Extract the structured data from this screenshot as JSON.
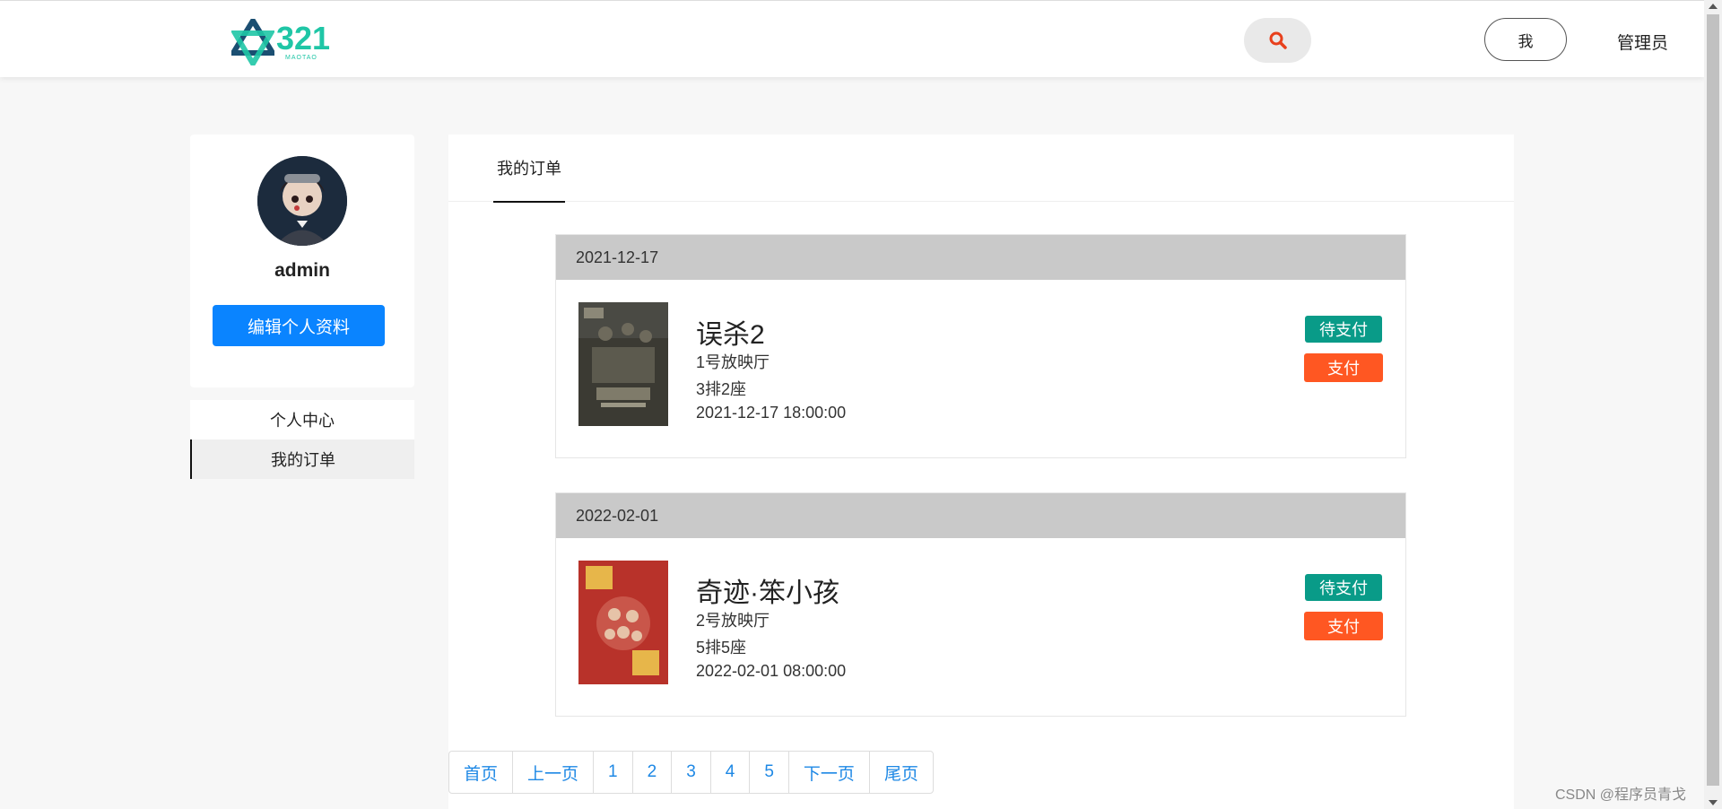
{
  "header": {
    "logo_text": "321",
    "logo_sub": "MAOTAO",
    "me_label": "我",
    "admin_label": "管理员"
  },
  "profile": {
    "username": "admin",
    "edit_label": "编辑个人资料"
  },
  "sidebar": {
    "items": [
      {
        "label": "个人中心",
        "active": false
      },
      {
        "label": "我的订单",
        "active": true
      }
    ]
  },
  "main": {
    "tab_label": "我的订单",
    "orders": [
      {
        "date": "2021-12-17",
        "title": "误杀2",
        "hall": "1号放映厅",
        "seat": "3排2座",
        "showtime": "2021-12-17 18:00:00",
        "status": "待支付",
        "pay_label": "支付"
      },
      {
        "date": "2022-02-01",
        "title": "奇迹·笨小孩",
        "hall": "2号放映厅",
        "seat": "5排5座",
        "showtime": "2022-02-01 08:00:00",
        "status": "待支付",
        "pay_label": "支付"
      }
    ]
  },
  "pagination": {
    "first": "首页",
    "prev": "上一页",
    "pages": [
      "1",
      "2",
      "3",
      "4",
      "5"
    ],
    "next": "下一页",
    "last": "尾页"
  },
  "watermark": "CSDN @程序员青戈",
  "colors": {
    "primary": "#0a84ff",
    "status": "#099b88",
    "pay": "#ff5722",
    "link": "#1e88e5"
  }
}
